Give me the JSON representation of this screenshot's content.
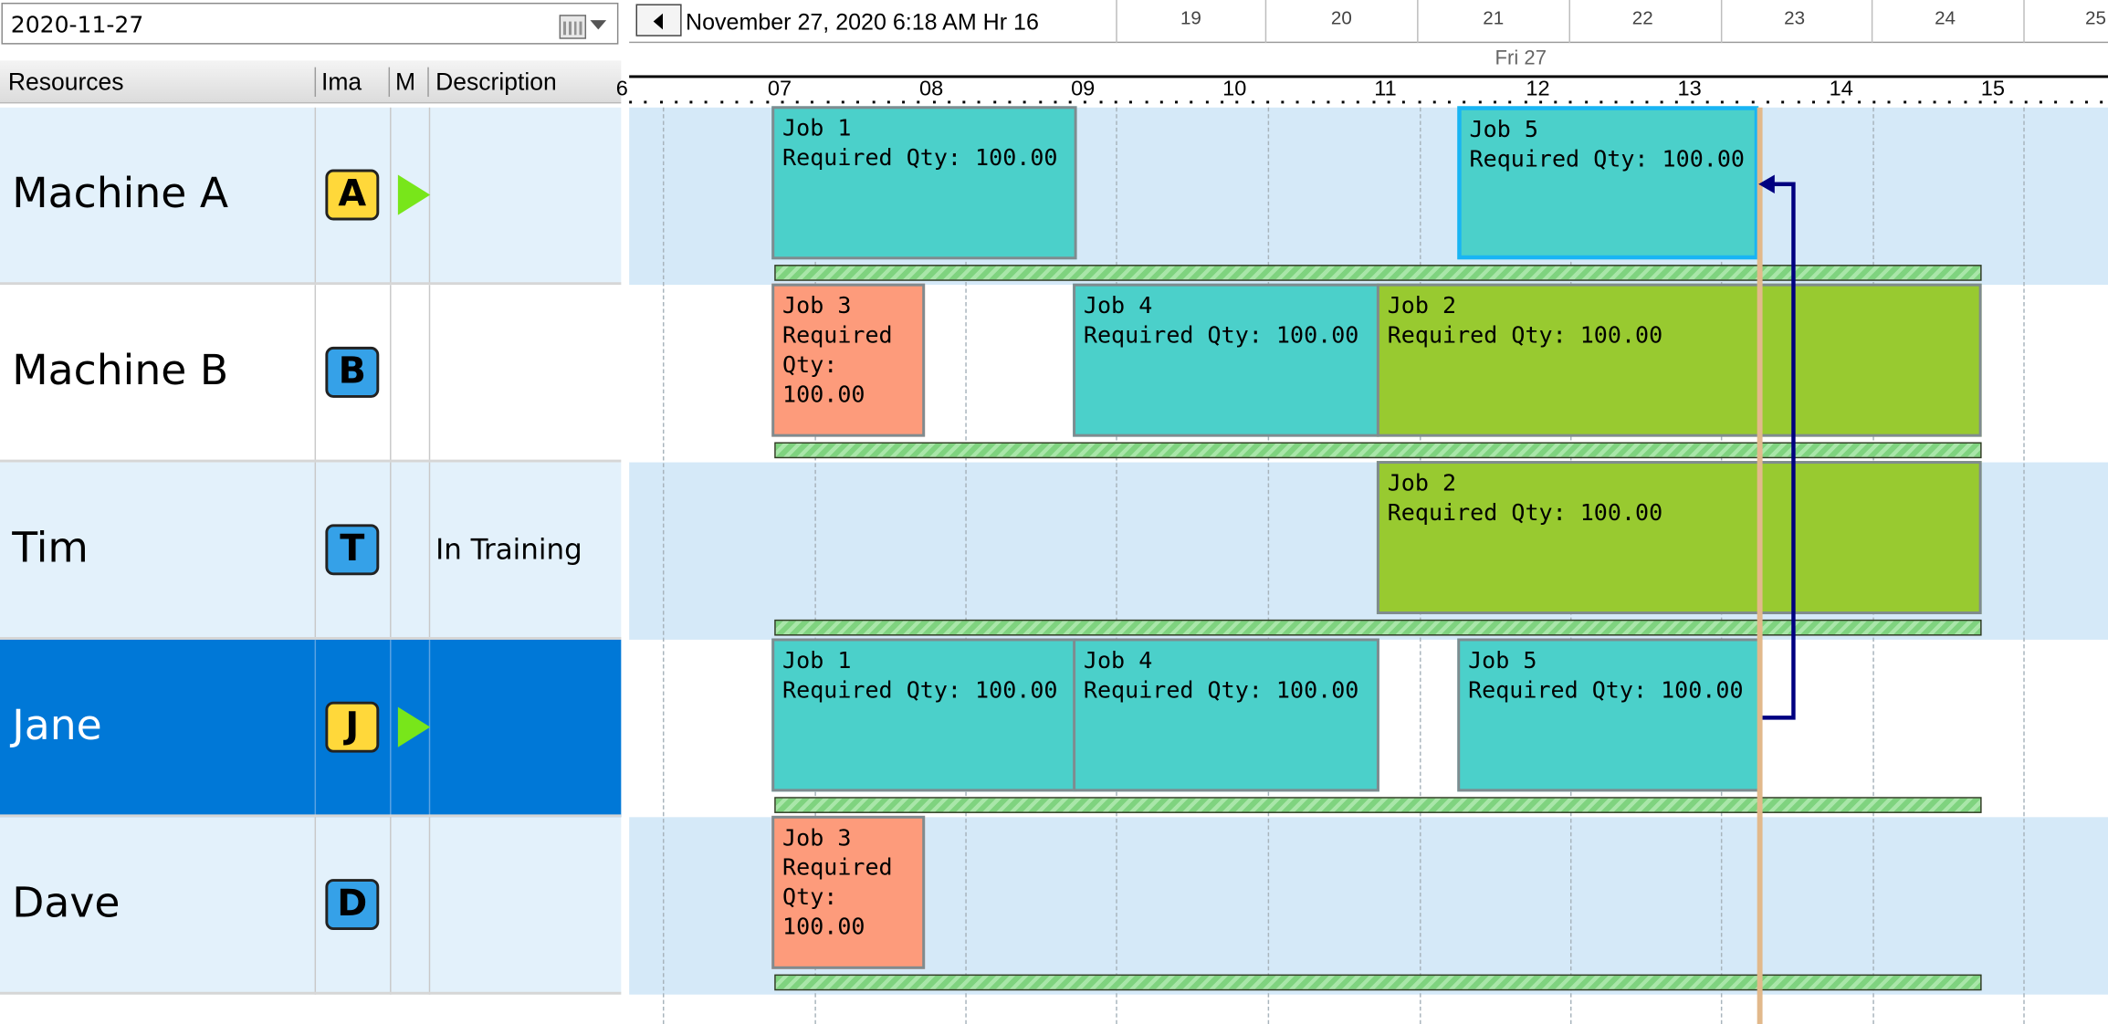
{
  "date_picker": {
    "value": "2020-11-27"
  },
  "grid": {
    "columns": [
      "Resources",
      "Ima",
      "M",
      "Description"
    ],
    "rows": [
      {
        "name": "Machine A",
        "badge": "A",
        "badge_color": "#ffd83a",
        "has_marker": true,
        "description": ""
      },
      {
        "name": "Machine B",
        "badge": "B",
        "badge_color": "#35a1e8",
        "has_marker": false,
        "description": ""
      },
      {
        "name": "Tim",
        "badge": "T",
        "badge_color": "#35a1e8",
        "has_marker": false,
        "description": "In Training"
      },
      {
        "name": "Jane",
        "badge": "J",
        "badge_color": "#ffd83a",
        "has_marker": true,
        "description": ""
      },
      {
        "name": "Dave",
        "badge": "D",
        "badge_color": "#35a1e8",
        "has_marker": false,
        "description": ""
      }
    ],
    "selected_row": "Jane",
    "selection_color": "#0078d7"
  },
  "timeline": {
    "current": "November 27, 2020  6:18 AM   Hr 16",
    "hour_columns": [
      "19",
      "20",
      "21",
      "22",
      "23",
      "24",
      "25"
    ],
    "day": "Fri 27",
    "ticks": [
      "6",
      "07",
      "08",
      "09",
      "10",
      "11",
      "12",
      "13",
      "14",
      "15"
    ],
    "jobs": {
      "machine_a": [
        {
          "title": "Job 1",
          "detail": "Required Qty: 100.00",
          "color": "cyan"
        },
        {
          "title": "Job 5",
          "detail": "Required Qty: 100.00",
          "color": "cyan",
          "selected": true
        }
      ],
      "machine_b": [
        {
          "title": "Job 3",
          "detail": "Required\nQty:\n100.00",
          "color": "salmon"
        },
        {
          "title": "Job 4",
          "detail": "Required Qty: 100.00",
          "color": "cyan"
        },
        {
          "title": "Job 2",
          "detail": "Required Qty: 100.00",
          "color": "green"
        }
      ],
      "tim": [
        {
          "title": "Job 2",
          "detail": "Required Qty: 100.00",
          "color": "green"
        }
      ],
      "jane": [
        {
          "title": "Job 1",
          "detail": "Required Qty: 100.00",
          "color": "cyan"
        },
        {
          "title": "Job 4",
          "detail": "Required Qty: 100.00",
          "color": "cyan"
        },
        {
          "title": "Job 5",
          "detail": "Required Qty: 100.00",
          "color": "cyan"
        }
      ],
      "dave": [
        {
          "title": "Job 3",
          "detail": "Required\nQty:\n100.00",
          "color": "salmon"
        }
      ]
    },
    "link_color": "#000080",
    "now_line_color": "#e2b98b"
  }
}
